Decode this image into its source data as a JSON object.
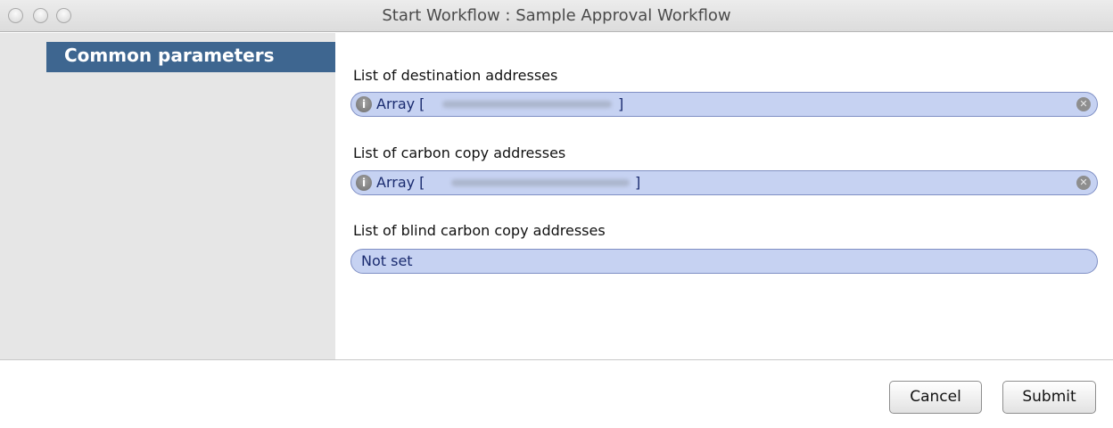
{
  "window": {
    "title": "Start Workflow : Sample Approval Workflow"
  },
  "sidebar": {
    "items": [
      {
        "label": "Common parameters",
        "selected": true
      }
    ]
  },
  "fields": [
    {
      "label": "List of destination addresses",
      "prefix": "Array [",
      "suffix": "]",
      "has_info_icon": true,
      "has_clear_icon": true
    },
    {
      "label": "List of carbon copy addresses",
      "prefix": "Array [",
      "suffix": "]",
      "has_info_icon": true,
      "has_clear_icon": true
    },
    {
      "label": "List of blind carbon copy addresses",
      "value": "Not set",
      "has_info_icon": false,
      "has_clear_icon": false
    }
  ],
  "icons": {
    "info": "info-icon",
    "clear": "clear-icon"
  },
  "footer": {
    "cancel_label": "Cancel",
    "submit_label": "Submit"
  },
  "colors": {
    "sidebar_selected": "#3e6690",
    "field_background": "#c6d2f2",
    "field_border": "#7f8fc4",
    "field_text": "#1a2b6f"
  }
}
